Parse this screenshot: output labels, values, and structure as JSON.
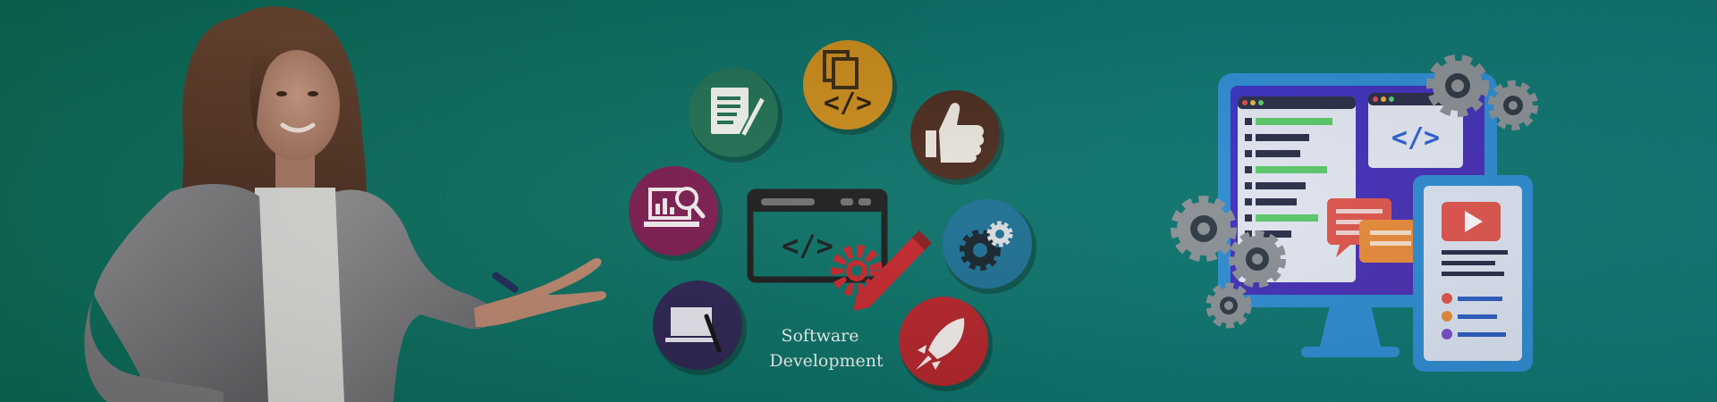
{
  "banner": {
    "caption": {
      "line1": "Software",
      "line2": "Development"
    },
    "icons": [
      "document-edit-icon",
      "code-files-icon",
      "thumbs-up-icon",
      "analytics-laptop-icon",
      "settings-gears-icon",
      "laptop-design-icon",
      "rocket-icon",
      "code-window-icon",
      "gear-pencil-icon",
      "monitor-code-illustration"
    ],
    "colors": {
      "background": "#0b6a55",
      "circle_green": "#1f6f52",
      "circle_orange": "#c98a1a",
      "circle_brown": "#4a2a1e",
      "circle_magenta": "#7a1a4e",
      "circle_blue": "#1c6f93",
      "circle_purple": "#2b2350",
      "circle_red": "#b3242a",
      "accent_red": "#c2262b"
    }
  }
}
